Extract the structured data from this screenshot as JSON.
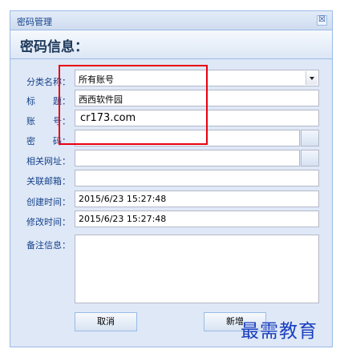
{
  "window": {
    "title": "密码管理",
    "close_symbol": "☒"
  },
  "header": {
    "title": "密码信息："
  },
  "form": {
    "category_label": "分类名称：",
    "category_value": "所有账号",
    "title_label": "标　　题：",
    "title_value": "西西软件园",
    "account_label": "账　　号：",
    "account_value": "cr173.com",
    "password_label": "密　　码：",
    "password_value": "",
    "url_label": "相关网址：",
    "url_value": "",
    "email_label": "关联邮箱：",
    "email_value": "",
    "created_label": "创建时间：",
    "created_value": "2015/6/23 15:27:48",
    "modified_label": "修改时间：",
    "modified_value": "2015/6/23 15:27:48",
    "notes_label": "备注信息：",
    "notes_value": ""
  },
  "buttons": {
    "cancel": "取消",
    "add": "新增"
  },
  "watermark": "最需教育",
  "colors": {
    "highlight": "#e8000f",
    "label": "#15428b",
    "panel": "#dfe8f6"
  }
}
